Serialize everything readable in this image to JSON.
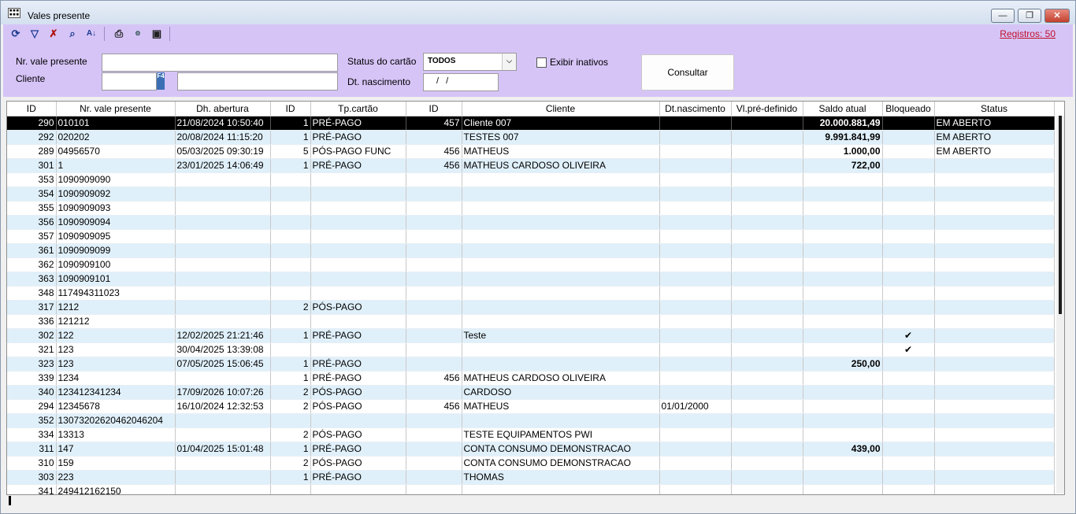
{
  "window": {
    "title": "Vales presente",
    "minimize": "—",
    "restore": "❐",
    "close": "✕"
  },
  "toolbar": {
    "icons": [
      "refresh-icon",
      "filter-icon",
      "clear-filter-icon",
      "search-icon",
      "sort-icon",
      "print-icon",
      "export-icon",
      "save-icon"
    ],
    "registros": "Registros: 50"
  },
  "filters": {
    "nr_vale_label": "Nr. vale presente",
    "nr_vale_value": "",
    "cliente_label": "Cliente",
    "cliente_id_value": "",
    "cliente_name_value": "",
    "f4_hint": "F4",
    "status_label": "Status do cartão",
    "status_value": "TODOS",
    "dt_nascimento_label": "Dt. nascimento",
    "dt_nascimento_value": " /  /",
    "exibir_inativos_label": "Exibir inativos",
    "exibir_inativos_checked": false,
    "consultar_label": "Consultar"
  },
  "table": {
    "headers": [
      "ID",
      "Nr. vale presente",
      "Dh. abertura",
      "ID",
      "Tp.cartão",
      "ID",
      "Cliente",
      "Dt.nascimento",
      "Vl.pré-definido",
      "Saldo atual",
      "Bloqueado",
      "Status"
    ],
    "rows": [
      [
        "290",
        "010101",
        "21/08/2024 10:50:40",
        "1",
        "PRÉ-PAGO",
        "457",
        "Cliente 007",
        "",
        "",
        "20.000.881,49",
        "",
        "EM ABERTO"
      ],
      [
        "292",
        "020202",
        "20/08/2024 11:15:20",
        "1",
        "PRÉ-PAGO",
        "",
        "TESTES 007",
        "",
        "",
        "9.991.841,99",
        "",
        "EM ABERTO"
      ],
      [
        "289",
        "04956570",
        "05/03/2025 09:30:19",
        "5",
        "PÓS-PAGO FUNC",
        "456",
        "MATHEUS",
        "",
        "",
        "1.000,00",
        "",
        "EM ABERTO"
      ],
      [
        "301",
        "1",
        "23/01/2025 14:06:49",
        "1",
        "PRÉ-PAGO",
        "456",
        "MATHEUS CARDOSO OLIVEIRA",
        "",
        "",
        "722,00",
        "",
        ""
      ],
      [
        "353",
        "1090909090",
        "",
        "",
        "",
        "",
        "",
        "",
        "",
        "",
        "",
        ""
      ],
      [
        "354",
        "1090909092",
        "",
        "",
        "",
        "",
        "",
        "",
        "",
        "",
        "",
        ""
      ],
      [
        "355",
        "1090909093",
        "",
        "",
        "",
        "",
        "",
        "",
        "",
        "",
        "",
        ""
      ],
      [
        "356",
        "1090909094",
        "",
        "",
        "",
        "",
        "",
        "",
        "",
        "",
        "",
        ""
      ],
      [
        "357",
        "1090909095",
        "",
        "",
        "",
        "",
        "",
        "",
        "",
        "",
        "",
        ""
      ],
      [
        "361",
        "1090909099",
        "",
        "",
        "",
        "",
        "",
        "",
        "",
        "",
        "",
        ""
      ],
      [
        "362",
        "1090909100",
        "",
        "",
        "",
        "",
        "",
        "",
        "",
        "",
        "",
        ""
      ],
      [
        "363",
        "1090909101",
        "",
        "",
        "",
        "",
        "",
        "",
        "",
        "",
        "",
        ""
      ],
      [
        "348",
        "117494311023",
        "",
        "",
        "",
        "",
        "",
        "",
        "",
        "",
        "",
        ""
      ],
      [
        "317",
        "1212",
        "",
        "2",
        "PÓS-PAGO",
        "",
        "",
        "",
        "",
        "",
        "",
        ""
      ],
      [
        "336",
        "121212",
        "",
        "",
        "",
        "",
        "",
        "",
        "",
        "",
        "",
        ""
      ],
      [
        "302",
        "122",
        "12/02/2025 21:21:46",
        "1",
        "PRÉ-PAGO",
        "",
        "Teste",
        "",
        "",
        "",
        "✔",
        ""
      ],
      [
        "321",
        "123",
        "30/04/2025 13:39:08",
        "",
        "",
        "",
        "",
        "",
        "",
        "",
        "✔",
        ""
      ],
      [
        "323",
        "123",
        "07/05/2025 15:06:45",
        "1",
        "PRÉ-PAGO",
        "",
        "",
        "",
        "",
        "250,00",
        "",
        ""
      ],
      [
        "339",
        "1234",
        "",
        "1",
        "PRÉ-PAGO",
        "456",
        "MATHEUS CARDOSO OLIVEIRA",
        "",
        "",
        "",
        "",
        ""
      ],
      [
        "340",
        "123412341234",
        "17/09/2026 10:07:26",
        "2",
        "PÓS-PAGO",
        "",
        "CARDOSO",
        "",
        "",
        "",
        "",
        ""
      ],
      [
        "294",
        "12345678",
        "16/10/2024 12:32:53",
        "2",
        "PÓS-PAGO",
        "456",
        "MATHEUS",
        "01/01/2000",
        "",
        "",
        "",
        ""
      ],
      [
        "352",
        "13073202620462046204",
        "",
        "",
        "",
        "",
        "",
        "",
        "",
        "",
        "",
        ""
      ],
      [
        "334",
        "13313",
        "",
        "2",
        "PÓS-PAGO",
        "",
        "TESTE EQUIPAMENTOS PWI",
        "",
        "",
        "",
        "",
        ""
      ],
      [
        "311",
        "147",
        "01/04/2025 15:01:48",
        "1",
        "PRÉ-PAGO",
        "",
        "CONTA CONSUMO DEMONSTRACAO",
        "",
        "",
        "439,00",
        "",
        ""
      ],
      [
        "310",
        "159",
        "",
        "2",
        "PÓS-PAGO",
        "",
        "CONTA CONSUMO DEMONSTRACAO",
        "",
        "",
        "",
        "",
        ""
      ],
      [
        "303",
        "223",
        "",
        "1",
        "PRÉ-PAGO",
        "",
        "THOMAS",
        "",
        "",
        "",
        "",
        ""
      ],
      [
        "341",
        "249412162150",
        "",
        "",
        "",
        "",
        "",
        "",
        "",
        "",
        "",
        ""
      ]
    ],
    "selected_row": 0
  }
}
